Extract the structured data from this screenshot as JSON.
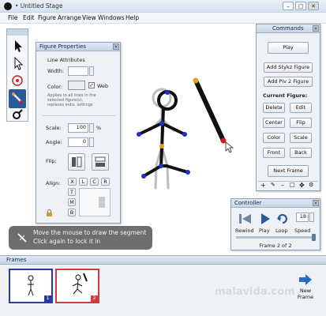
{
  "window": {
    "title": "• Untitled Stage",
    "buttons": [
      "–",
      "□",
      "✕"
    ]
  },
  "menu": [
    "File",
    "Edit",
    "Figure",
    "Arrange",
    "View",
    "Windows",
    "Help"
  ],
  "tools": [
    {
      "name": "select-arrow",
      "active": false
    },
    {
      "name": "select-point",
      "active": false
    },
    {
      "name": "pivot-point",
      "active": false
    },
    {
      "name": "draw-segment",
      "active": true
    },
    {
      "name": "add-figure",
      "active": false
    }
  ],
  "figure_properties": {
    "title": "Figure Properties",
    "line_attributes": "Line Attributes",
    "width_label": "Width:",
    "color_label": "Color:",
    "web_label": "Web",
    "applies_note": "Applies to all lines in the selected figure(s), replaces indiv. settings",
    "scale_label": "Scale:",
    "scale_value": "100",
    "scale_unit": "%",
    "angle_label": "Angle:",
    "angle_value": "0",
    "flip_label": "Flip:",
    "align_label": "Align:",
    "align_h": [
      "X",
      "L",
      "C",
      "R"
    ],
    "align_v": [
      "T",
      "M",
      "B"
    ]
  },
  "commands": {
    "title": "Commands",
    "play": "Play",
    "add_stykz": "Add Stykz Figure",
    "add_piv2": "Add Piv 2 Figure",
    "current_figure": "Current Figure:",
    "grid": [
      [
        "Delete",
        "Edit"
      ],
      [
        "Center",
        "Flip"
      ],
      [
        "Color",
        "Scale"
      ],
      [
        "Front",
        "Back"
      ]
    ],
    "next_frame": "Next Frame"
  },
  "controller": {
    "title": "Controller",
    "rewind": "Rewind",
    "play": "Play",
    "loop": "Loop",
    "speed": "Speed",
    "speed_value": "18",
    "frame_status": "Frame 2 of 2"
  },
  "tooltip": {
    "line1": "Move the mouse to draw the segment",
    "line2": "Click again to lock it in"
  },
  "frames": {
    "title": "Frames",
    "items": [
      {
        "number": "1"
      },
      {
        "number": "2"
      }
    ],
    "new_frame": "New\nFrame"
  },
  "watermark": "malavida.com",
  "colors": {
    "accent_blue": "#2a5a9a",
    "joint_blue": "#1f2fd0",
    "joint_orange": "#e0a21a",
    "joint_red": "#d11a1a",
    "frame1_border": "#2a3aa8",
    "frame2_border": "#d33b3b"
  }
}
